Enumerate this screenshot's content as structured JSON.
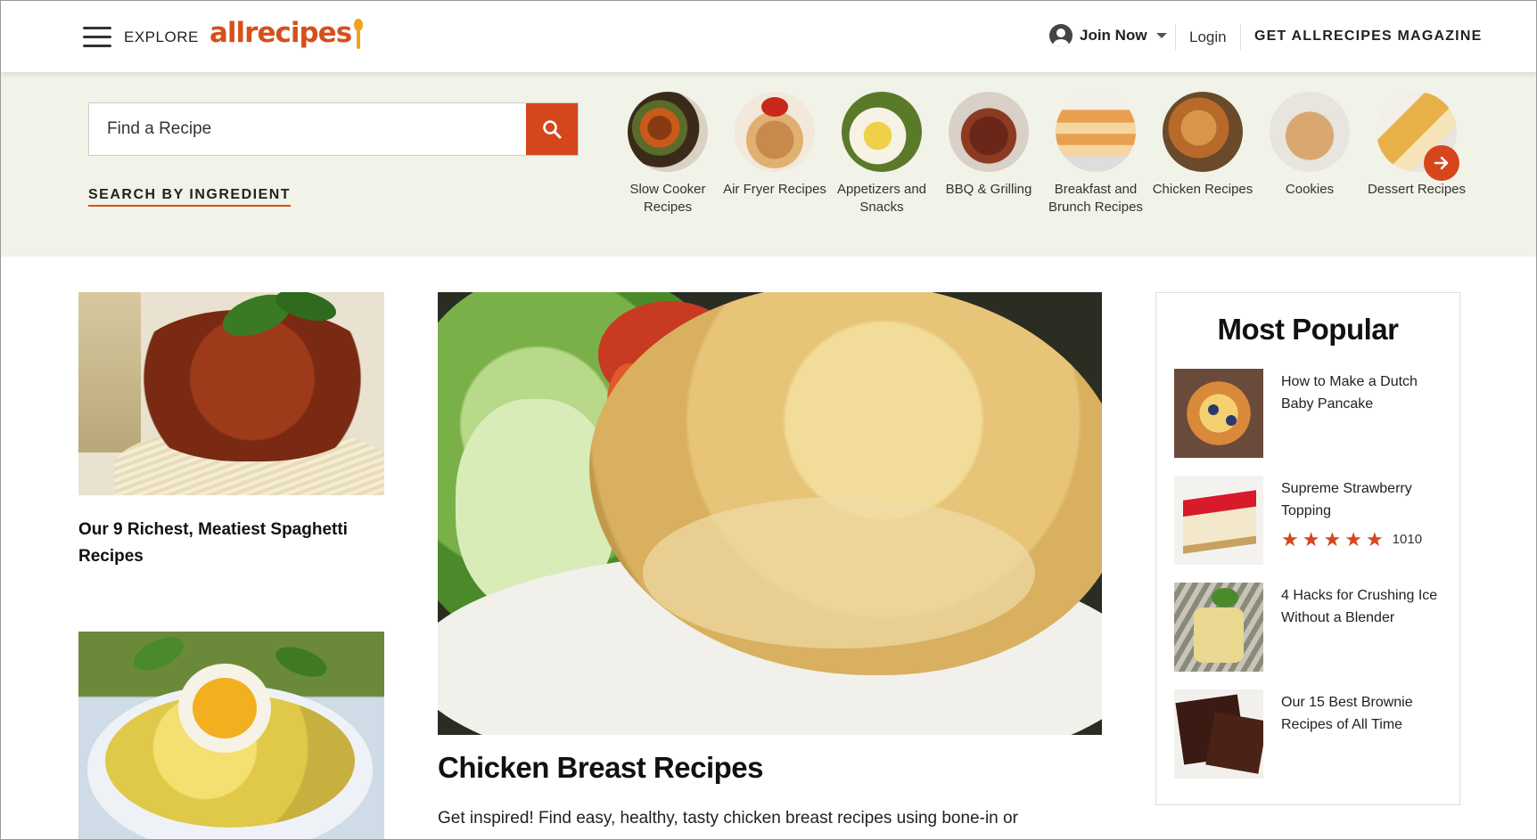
{
  "header": {
    "explore_label": "EXPLORE",
    "logo_text": "allrecipes",
    "join_label": "Join Now",
    "login_label": "Login",
    "magazine_label": "GET ALLRECIPES MAGAZINE"
  },
  "search": {
    "placeholder": "Find a Recipe",
    "ingredient_link": "SEARCH BY INGREDIENT"
  },
  "categories": [
    {
      "label": "Slow Cooker Recipes"
    },
    {
      "label": "Air Fryer Recipes"
    },
    {
      "label": "Appetizers and Snacks"
    },
    {
      "label": "BBQ & Grilling"
    },
    {
      "label": "Breakfast and Brunch Recipes"
    },
    {
      "label": "Chicken Recipes"
    },
    {
      "label": "Cookies"
    },
    {
      "label": "Dessert Recipes"
    }
  ],
  "left_cards": [
    {
      "title": "Our 9 Richest, Meatiest Spaghetti Recipes"
    }
  ],
  "hero": {
    "title": "Chicken Breast Recipes",
    "description": "Get inspired! Find easy, healthy, tasty chicken breast recipes using bone-in or"
  },
  "popular": {
    "title": "Most Popular",
    "items": [
      {
        "title": "How to Make a Dutch Baby Pancake"
      },
      {
        "title": "Supreme Strawberry Topping",
        "rating": 5,
        "rating_count": "1010"
      },
      {
        "title": "4 Hacks for Crushing Ice Without a Blender"
      },
      {
        "title": "Our 15 Best Brownie Recipes of All Time"
      }
    ]
  },
  "colors": {
    "brand": "#d5501c",
    "accent": "#d5461c",
    "band_bg": "#f1f2e8"
  }
}
